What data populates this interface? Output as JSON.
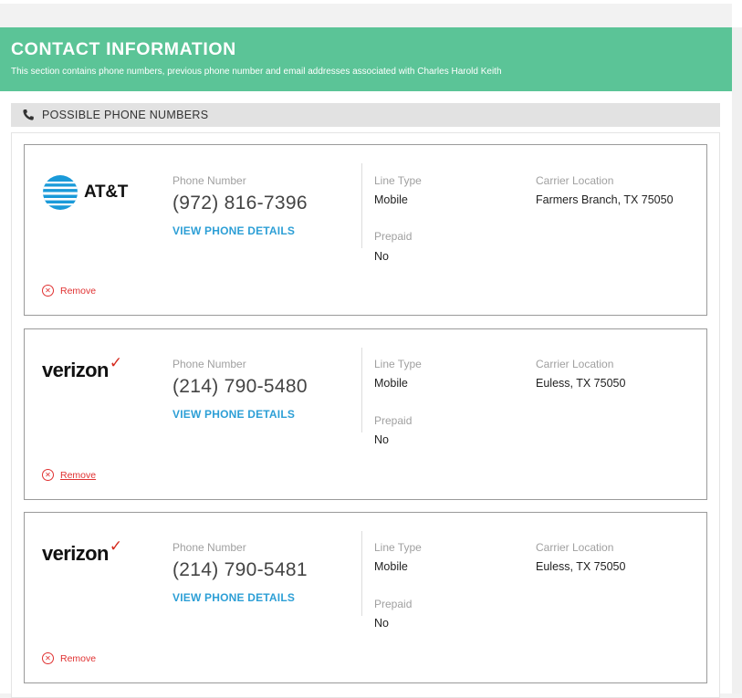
{
  "contact": {
    "title": "CONTACT INFORMATION",
    "subtitle": "This section contains phone numbers, previous phone number and email addresses associated with Charles Harold Keith"
  },
  "section": {
    "icon": "phone-icon",
    "title": "POSSIBLE PHONE NUMBERS"
  },
  "labels": {
    "phone_number": "Phone Number",
    "line_type": "Line Type",
    "carrier_location": "Carrier Location",
    "prepaid": "Prepaid",
    "view_details": "VIEW PHONE DETAILS",
    "remove": "Remove"
  },
  "colors": {
    "header_green": "#5bc497",
    "link_blue": "#2d9fd6",
    "remove_red": "#e03131",
    "verizon_red": "#d52b1e",
    "att_blue": "#1a9ad9"
  },
  "phones": [
    {
      "carrier": "AT&T",
      "logo_icon": "att-globe-icon",
      "number": "(972) 816-7396",
      "line_type": "Mobile",
      "carrier_location": "Farmers Branch, TX 75050",
      "prepaid": "No"
    },
    {
      "carrier": "verizon",
      "logo_mark": "✓",
      "number": "(214) 790-5480",
      "line_type": "Mobile",
      "carrier_location": "Euless, TX 75050",
      "prepaid": "No"
    },
    {
      "carrier": "verizon",
      "logo_mark": "✓",
      "number": "(214) 790-5481",
      "line_type": "Mobile",
      "carrier_location": "Euless, TX 75050",
      "prepaid": "No"
    }
  ]
}
